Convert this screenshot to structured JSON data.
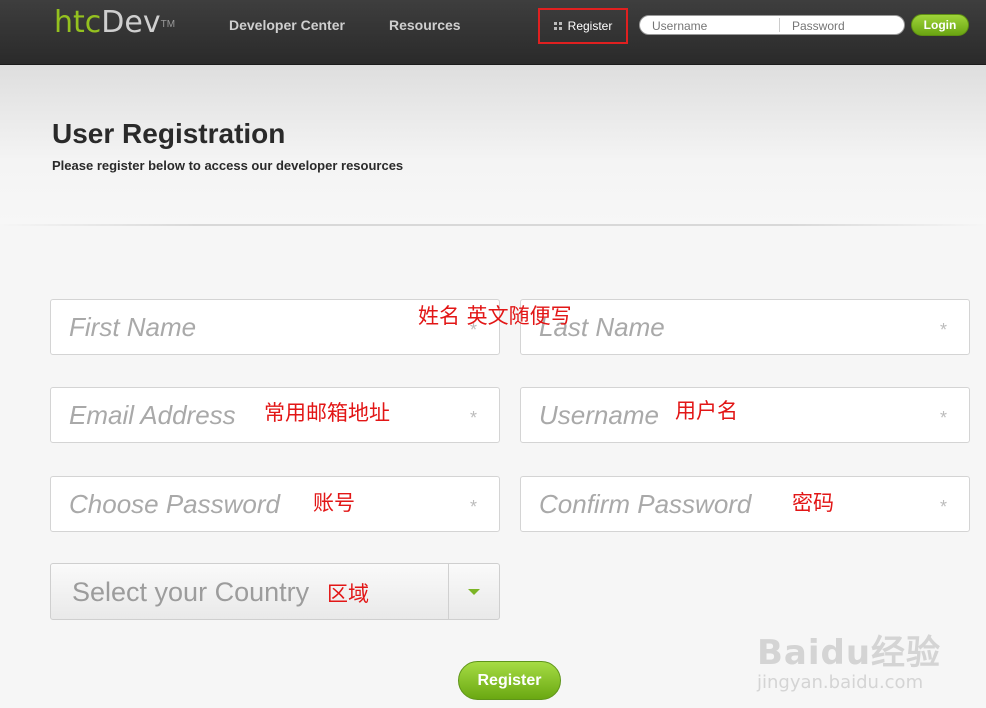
{
  "topbar": {
    "logo_htc": "htc",
    "logo_dev": "Dev",
    "logo_tm": "TM",
    "nav": [
      "Developer Center",
      "Resources"
    ],
    "register_label": "Register",
    "username_placeholder": "Username",
    "password_placeholder": "Password",
    "login_label": "Login"
  },
  "page": {
    "title": "User Registration",
    "subtitle": "Please register below to access our developer resources"
  },
  "form": {
    "first_name": "First Name",
    "last_name": "Last Name",
    "email": "Email Address",
    "username": "Username",
    "choose_password": "Choose Password",
    "confirm_password": "Confirm Password",
    "country": "Select your Country",
    "required_mark": "*",
    "submit_label": "Register"
  },
  "annotations": {
    "name": "姓名 英文随便写",
    "email": "常用邮箱地址",
    "username": "用户名",
    "account": "账号",
    "password": "密码",
    "region": "区域"
  },
  "watermark": {
    "main": "Baidu经验",
    "url": "jingyan.baidu.com"
  },
  "colors": {
    "accent_green": "#7cb526",
    "annotation_red": "#e21616",
    "topbar_dark": "#333333"
  }
}
